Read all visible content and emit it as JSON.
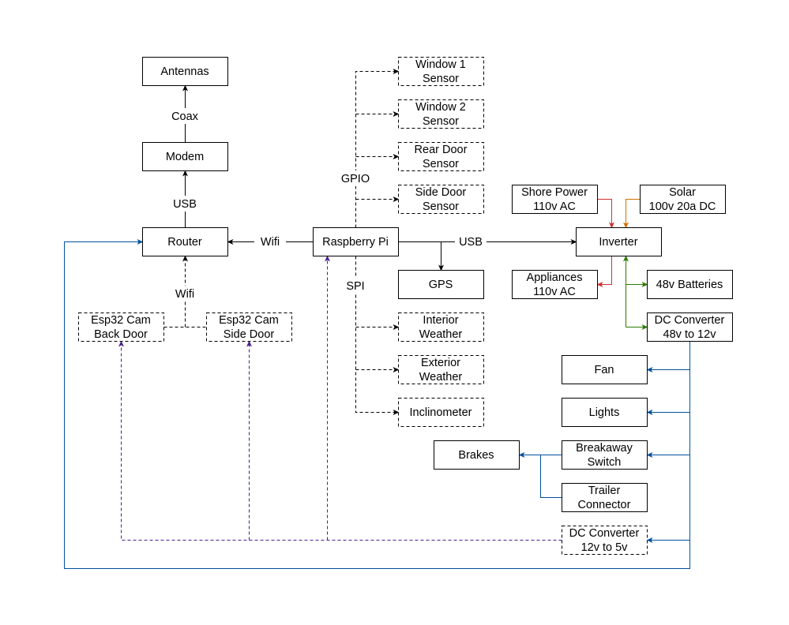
{
  "colors": {
    "black": "#000000",
    "red": "#d32f2f",
    "orange": "#d07000",
    "green": "#2d7a00",
    "blue": "#00509e",
    "purple": "#4a1f8c"
  },
  "nodes": {
    "antennas": [
      "Antennas"
    ],
    "modem": [
      "Modem"
    ],
    "router": [
      "Router"
    ],
    "raspberry_pi": [
      "Raspberry Pi"
    ],
    "window1": [
      "Window 1",
      "Sensor"
    ],
    "window2": [
      "Window 2",
      "Sensor"
    ],
    "rear_door": [
      "Rear Door",
      "Sensor"
    ],
    "side_door": [
      "Side Door",
      "Sensor"
    ],
    "gps": [
      "GPS"
    ],
    "interior_weather": [
      "Interior",
      "Weather"
    ],
    "exterior_weather": [
      "Exterior",
      "Weather"
    ],
    "inclinometer": [
      "Inclinometer"
    ],
    "shore_power": [
      "Shore Power",
      "110v AC"
    ],
    "solar": [
      "Solar",
      "100v 20a DC"
    ],
    "inverter": [
      "Inverter"
    ],
    "appliances": [
      "Appliances",
      "110v AC"
    ],
    "batteries": [
      "48v Batteries"
    ],
    "dc_48_12": [
      "DC Converter",
      "48v to 12v"
    ],
    "fan": [
      "Fan"
    ],
    "lights": [
      "Lights"
    ],
    "breakaway": [
      "Breakaway",
      "Switch"
    ],
    "brakes": [
      "Brakes"
    ],
    "trailer_connector": [
      "Trailer",
      "Connector"
    ],
    "dc_12_5": [
      "DC Converter",
      "12v to 5v"
    ],
    "esp_back": [
      "Esp32 Cam",
      "Back Door"
    ],
    "esp_side": [
      "Esp32 Cam",
      "Side Door"
    ]
  },
  "edge_labels": {
    "coax": "Coax",
    "usb_modem": "USB",
    "wifi_pi": "Wifi",
    "usb_inverter": "USB",
    "gpio": "GPIO",
    "spi": "SPI",
    "wifi_esp": "Wifi"
  }
}
